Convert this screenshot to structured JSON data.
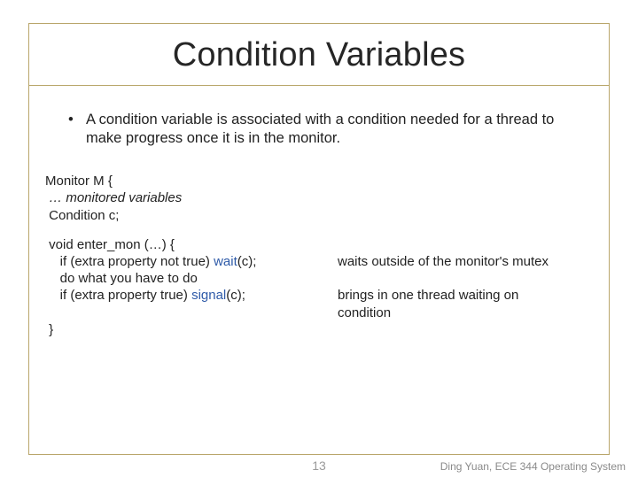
{
  "title": "Condition Variables",
  "bullet": {
    "marker": "•",
    "text": "A condition variable is associated with a condition needed for a thread to make progress once it is in the monitor."
  },
  "code": {
    "line1": "Monitor M {",
    "line2": " … monitored variables",
    "line3": " Condition c;",
    "fn_open": " void enter_mon (…) {",
    "fn_if1_prefix": "    if (extra property not true) ",
    "fn_if1_call": "wait",
    "fn_if1_suffix": "(c);",
    "fn_do": "    do what you have to do",
    "fn_if2_prefix": "    if (extra property true) ",
    "fn_if2_call": "signal",
    "fn_if2_suffix": "(c);",
    "fn_close": " }"
  },
  "annotations": {
    "wait": "waits outside of the monitor's mutex",
    "signal": "brings in one thread waiting on condition"
  },
  "page_number": "13",
  "footer": "Ding Yuan, ECE 344 Operating System"
}
